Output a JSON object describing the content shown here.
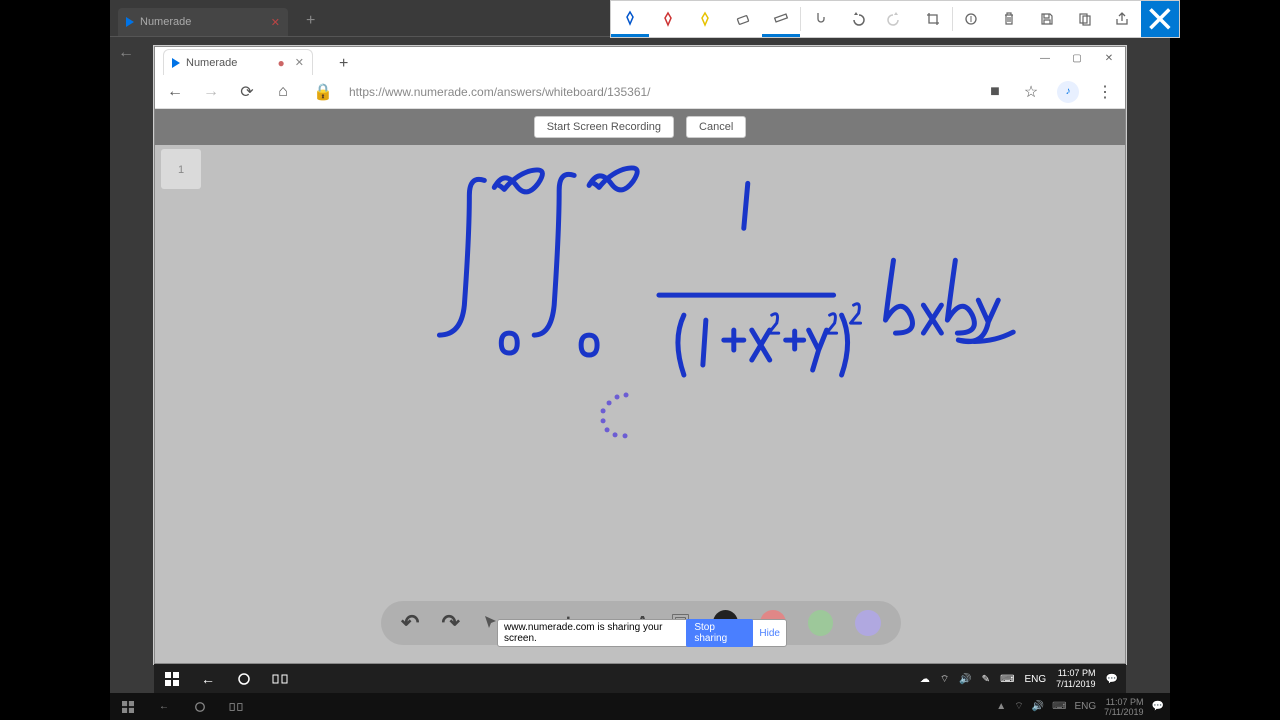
{
  "snipToolbar": {
    "tools": [
      "pen-blue",
      "pen-red",
      "pen-yellow",
      "eraser",
      "ruler",
      "touch",
      "undo",
      "redo",
      "crop",
      "history",
      "trash",
      "save",
      "copy",
      "share"
    ],
    "close": "×"
  },
  "bgBrowser": {
    "tabTitle": "Numerade",
    "newTab": "+"
  },
  "fgBrowser": {
    "tabTitle": "Numerade",
    "modified": "●",
    "close": "✕",
    "newTab": "+",
    "url": "https://www.numerade.com/answers/whiteboard/135361/",
    "winMin": "—",
    "winMax": "▢",
    "winClose": "✕"
  },
  "recordBar": {
    "start": "Start Screen Recording",
    "cancel": "Cancel"
  },
  "whiteboard": {
    "colors": [
      "#222",
      "#e06666",
      "#8fbf6f",
      "#9fa8da"
    ]
  },
  "shareBar": {
    "text": "www.numerade.com is sharing your screen.",
    "stop": "Stop sharing",
    "hide": "Hide"
  },
  "taskbarFg": {
    "lang": "ENG",
    "time": "11:07 PM",
    "date": "7/11/2019"
  },
  "taskbarBg": {
    "lang": "ENG",
    "time": "11:07 PM",
    "date": "7/11/2019"
  },
  "icons": {
    "backArrow": "←",
    "fwdArrow": "→",
    "reload": "⟳",
    "home": "⌂",
    "lock": "🔒",
    "cam": "■",
    "star": "☆",
    "menu": "⋮",
    "undo": "↶",
    "redo": "↷",
    "img": "🖼"
  }
}
